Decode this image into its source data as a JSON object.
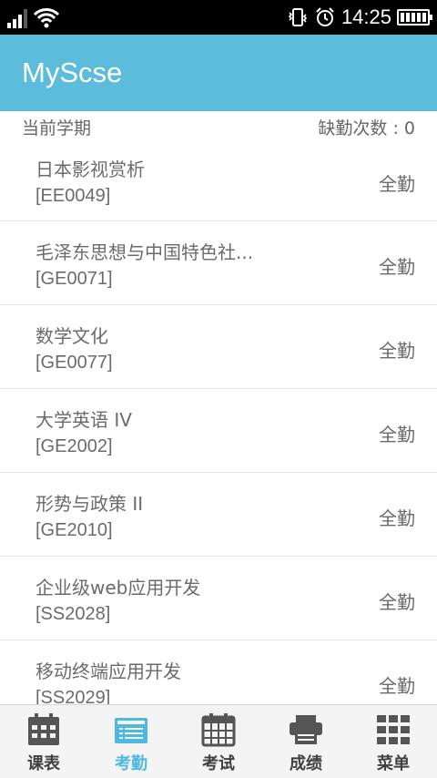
{
  "status_bar": {
    "time": "14:25",
    "icons": [
      "signal-icon",
      "wifi-icon",
      "vibrate-icon",
      "alarm-icon",
      "battery-icon"
    ]
  },
  "app": {
    "title": "MyScse",
    "header_color": "#5bbcdc"
  },
  "semester": {
    "label": "当前学期",
    "absence_text": "缺勤次数 : 0"
  },
  "courses": [
    {
      "name": "日本影视赏析",
      "code": "[EE0049]",
      "status": "全勤"
    },
    {
      "name": "毛泽东思想与中国特色社...",
      "code": "[GE0071]",
      "status": "全勤"
    },
    {
      "name": "数学文化",
      "code": "[GE0077]",
      "status": "全勤"
    },
    {
      "name": "大学英语 IV",
      "code": "[GE2002]",
      "status": "全勤"
    },
    {
      "name": "形势与政策 II",
      "code": "[GE2010]",
      "status": "全勤"
    },
    {
      "name": "企业级web应用开发",
      "code": "[SS2028]",
      "status": "全勤"
    },
    {
      "name": "移动终端应用开发",
      "code": "[SS2029]",
      "status": "全勤"
    }
  ],
  "bottom_nav": {
    "active_color": "#4eb8df",
    "items": [
      {
        "label": "课表",
        "icon": "calendar-grid-icon",
        "active": false
      },
      {
        "label": "考勤",
        "icon": "attendance-list-icon",
        "active": true
      },
      {
        "label": "考试",
        "icon": "exam-calendar-icon",
        "active": false
      },
      {
        "label": "成绩",
        "icon": "printer-icon",
        "active": false
      },
      {
        "label": "菜单",
        "icon": "grid-menu-icon",
        "active": false
      }
    ]
  }
}
